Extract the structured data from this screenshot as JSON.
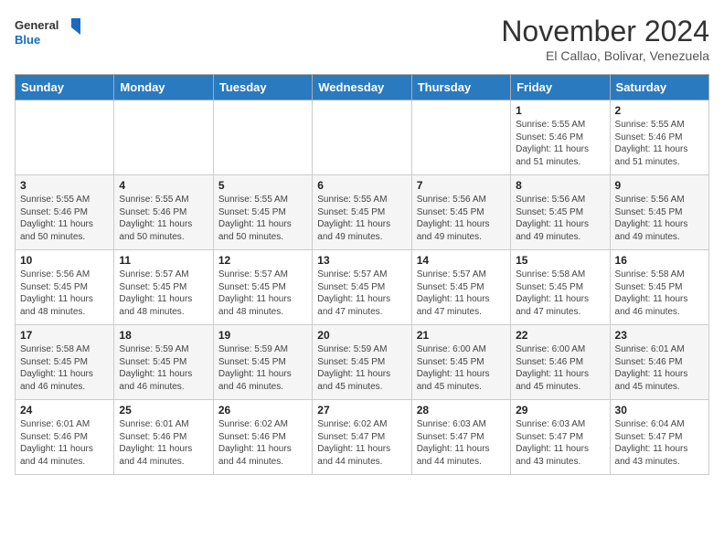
{
  "header": {
    "logo_general": "General",
    "logo_blue": "Blue",
    "month_title": "November 2024",
    "subtitle": "El Callao, Bolivar, Venezuela"
  },
  "weekdays": [
    "Sunday",
    "Monday",
    "Tuesday",
    "Wednesday",
    "Thursday",
    "Friday",
    "Saturday"
  ],
  "weeks": [
    [
      {
        "day": "",
        "info": ""
      },
      {
        "day": "",
        "info": ""
      },
      {
        "day": "",
        "info": ""
      },
      {
        "day": "",
        "info": ""
      },
      {
        "day": "",
        "info": ""
      },
      {
        "day": "1",
        "info": "Sunrise: 5:55 AM\nSunset: 5:46 PM\nDaylight: 11 hours and 51 minutes."
      },
      {
        "day": "2",
        "info": "Sunrise: 5:55 AM\nSunset: 5:46 PM\nDaylight: 11 hours and 51 minutes."
      }
    ],
    [
      {
        "day": "3",
        "info": "Sunrise: 5:55 AM\nSunset: 5:46 PM\nDaylight: 11 hours and 50 minutes."
      },
      {
        "day": "4",
        "info": "Sunrise: 5:55 AM\nSunset: 5:46 PM\nDaylight: 11 hours and 50 minutes."
      },
      {
        "day": "5",
        "info": "Sunrise: 5:55 AM\nSunset: 5:45 PM\nDaylight: 11 hours and 50 minutes."
      },
      {
        "day": "6",
        "info": "Sunrise: 5:55 AM\nSunset: 5:45 PM\nDaylight: 11 hours and 49 minutes."
      },
      {
        "day": "7",
        "info": "Sunrise: 5:56 AM\nSunset: 5:45 PM\nDaylight: 11 hours and 49 minutes."
      },
      {
        "day": "8",
        "info": "Sunrise: 5:56 AM\nSunset: 5:45 PM\nDaylight: 11 hours and 49 minutes."
      },
      {
        "day": "9",
        "info": "Sunrise: 5:56 AM\nSunset: 5:45 PM\nDaylight: 11 hours and 49 minutes."
      }
    ],
    [
      {
        "day": "10",
        "info": "Sunrise: 5:56 AM\nSunset: 5:45 PM\nDaylight: 11 hours and 48 minutes."
      },
      {
        "day": "11",
        "info": "Sunrise: 5:57 AM\nSunset: 5:45 PM\nDaylight: 11 hours and 48 minutes."
      },
      {
        "day": "12",
        "info": "Sunrise: 5:57 AM\nSunset: 5:45 PM\nDaylight: 11 hours and 48 minutes."
      },
      {
        "day": "13",
        "info": "Sunrise: 5:57 AM\nSunset: 5:45 PM\nDaylight: 11 hours and 47 minutes."
      },
      {
        "day": "14",
        "info": "Sunrise: 5:57 AM\nSunset: 5:45 PM\nDaylight: 11 hours and 47 minutes."
      },
      {
        "day": "15",
        "info": "Sunrise: 5:58 AM\nSunset: 5:45 PM\nDaylight: 11 hours and 47 minutes."
      },
      {
        "day": "16",
        "info": "Sunrise: 5:58 AM\nSunset: 5:45 PM\nDaylight: 11 hours and 46 minutes."
      }
    ],
    [
      {
        "day": "17",
        "info": "Sunrise: 5:58 AM\nSunset: 5:45 PM\nDaylight: 11 hours and 46 minutes."
      },
      {
        "day": "18",
        "info": "Sunrise: 5:59 AM\nSunset: 5:45 PM\nDaylight: 11 hours and 46 minutes."
      },
      {
        "day": "19",
        "info": "Sunrise: 5:59 AM\nSunset: 5:45 PM\nDaylight: 11 hours and 46 minutes."
      },
      {
        "day": "20",
        "info": "Sunrise: 5:59 AM\nSunset: 5:45 PM\nDaylight: 11 hours and 45 minutes."
      },
      {
        "day": "21",
        "info": "Sunrise: 6:00 AM\nSunset: 5:45 PM\nDaylight: 11 hours and 45 minutes."
      },
      {
        "day": "22",
        "info": "Sunrise: 6:00 AM\nSunset: 5:46 PM\nDaylight: 11 hours and 45 minutes."
      },
      {
        "day": "23",
        "info": "Sunrise: 6:01 AM\nSunset: 5:46 PM\nDaylight: 11 hours and 45 minutes."
      }
    ],
    [
      {
        "day": "24",
        "info": "Sunrise: 6:01 AM\nSunset: 5:46 PM\nDaylight: 11 hours and 44 minutes."
      },
      {
        "day": "25",
        "info": "Sunrise: 6:01 AM\nSunset: 5:46 PM\nDaylight: 11 hours and 44 minutes."
      },
      {
        "day": "26",
        "info": "Sunrise: 6:02 AM\nSunset: 5:46 PM\nDaylight: 11 hours and 44 minutes."
      },
      {
        "day": "27",
        "info": "Sunrise: 6:02 AM\nSunset: 5:47 PM\nDaylight: 11 hours and 44 minutes."
      },
      {
        "day": "28",
        "info": "Sunrise: 6:03 AM\nSunset: 5:47 PM\nDaylight: 11 hours and 44 minutes."
      },
      {
        "day": "29",
        "info": "Sunrise: 6:03 AM\nSunset: 5:47 PM\nDaylight: 11 hours and 43 minutes."
      },
      {
        "day": "30",
        "info": "Sunrise: 6:04 AM\nSunset: 5:47 PM\nDaylight: 11 hours and 43 minutes."
      }
    ]
  ]
}
